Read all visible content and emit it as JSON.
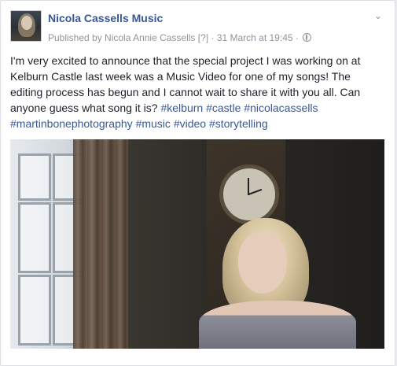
{
  "post": {
    "page_name": "Nicola Cassells Music",
    "published_by": "Published by Nicola Annie Cassells",
    "help_marker": "[?]",
    "separator": "·",
    "timestamp": "31 March at 19:45",
    "separator2": "·",
    "privacy_icon": "globe-icon",
    "options_icon": "chevron-down-icon",
    "body_text": "I'm very excited to announce that the special project I was working on at Kelburn Castle last week was a Music Video for one of my songs! The editing process has begun and I cannot wait to share it with you all. Can anyone guess what song it is? ",
    "hashtags": [
      "#kelburn",
      "#castle",
      "#nicolacassells",
      "#martinbonephotography",
      "#music",
      "#video",
      "#storytelling"
    ]
  },
  "colors": {
    "link": "#365899",
    "text": "#1d2129",
    "meta": "#90949c",
    "background": "#e9ebee"
  }
}
